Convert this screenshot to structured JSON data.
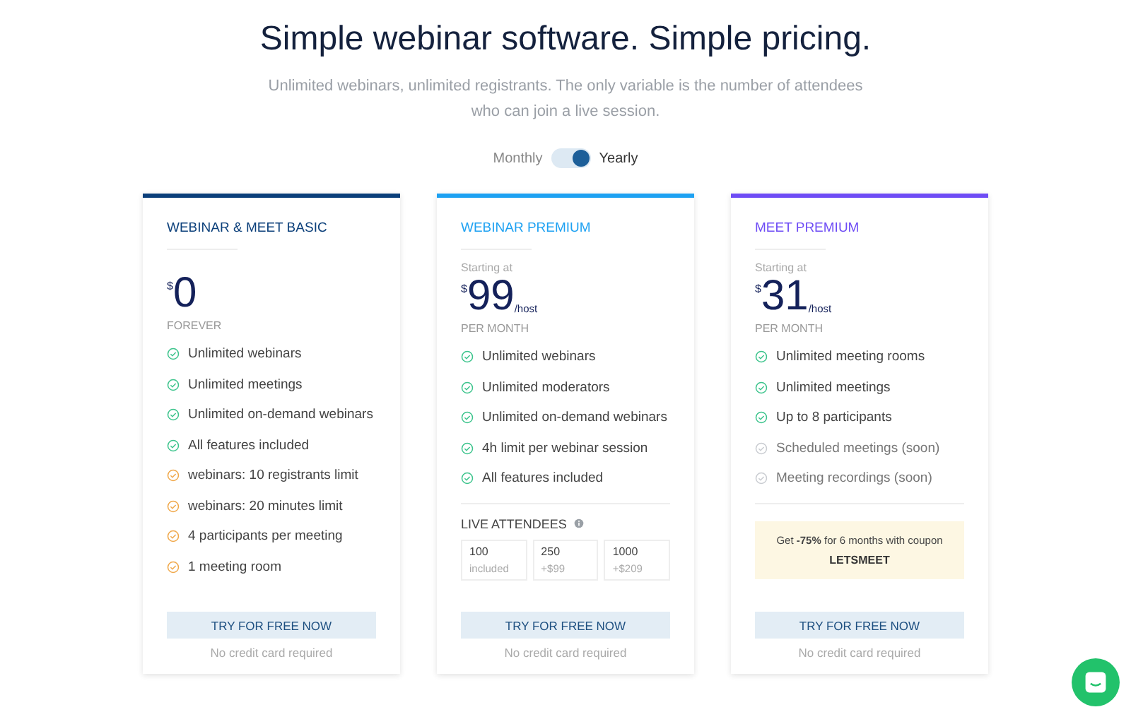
{
  "header": {
    "title": "Simple webinar software. Simple pricing.",
    "subtitle": "Unlimited webinars, unlimited registrants. The only variable is the number of attendees who can join a live session."
  },
  "billing_toggle": {
    "options": [
      {
        "label": "Monthly",
        "selected": false
      },
      {
        "label": "Yearly",
        "selected": true
      }
    ]
  },
  "plans": [
    {
      "name": "WEBINAR & MEET BASIC",
      "color": "#0b3f7a",
      "currency": "$",
      "price": "0",
      "period": "FOREVER",
      "features": [
        {
          "text": "Unlimited webinars",
          "kind": "included"
        },
        {
          "text": "Unlimited meetings",
          "kind": "included"
        },
        {
          "text": "Unlimited on-demand webinars",
          "kind": "included"
        },
        {
          "text": "All features included",
          "kind": "included"
        },
        {
          "text": "webinars: 10 registrants limit",
          "kind": "limited"
        },
        {
          "text": "webinars: 20 minutes limit",
          "kind": "limited"
        },
        {
          "text": "4 participants per meeting",
          "kind": "limited"
        },
        {
          "text": "1 meeting room",
          "kind": "limited"
        }
      ],
      "button": "TRY FOR FREE NOW",
      "note": "No credit card required"
    },
    {
      "name": "WEBINAR PREMIUM",
      "color": "#1da1f2",
      "starting": "Starting at",
      "currency": "$",
      "price": "99",
      "unit": "/host",
      "period": "PER MONTH",
      "features": [
        {
          "text": "Unlimited webinars",
          "kind": "included"
        },
        {
          "text": "Unlimited moderators",
          "kind": "included"
        },
        {
          "text": "Unlimited on-demand webinars",
          "kind": "included"
        },
        {
          "text": "4h limit per webinar session",
          "kind": "included"
        },
        {
          "text": "All features included",
          "kind": "included"
        }
      ],
      "attendees": {
        "label": "LIVE ATTENDEES",
        "options": [
          {
            "count": "100",
            "price": "included"
          },
          {
            "count": "250",
            "price": "+$99"
          },
          {
            "count": "1000",
            "price": "+$209"
          }
        ]
      },
      "button": "TRY FOR FREE NOW",
      "note": "No credit card required"
    },
    {
      "name": "MEET PREMIUM",
      "color": "#6e4cf5",
      "starting": "Starting at",
      "currency": "$",
      "price": "31",
      "unit": "/host",
      "period": "PER MONTH",
      "features": [
        {
          "text": "Unlimited meeting rooms",
          "kind": "included"
        },
        {
          "text": "Unlimited meetings",
          "kind": "included"
        },
        {
          "text": "Up to 8 participants",
          "kind": "included"
        },
        {
          "text": "Scheduled meetings (soon)",
          "kind": "soon"
        },
        {
          "text": "Meeting recordings (soon)",
          "kind": "soon"
        }
      ],
      "coupon": {
        "text": "Get **-75%** for 6 months with coupon",
        "code": "LETSMEET"
      },
      "button": "TRY FOR FREE NOW",
      "note": "No credit card required"
    }
  ]
}
